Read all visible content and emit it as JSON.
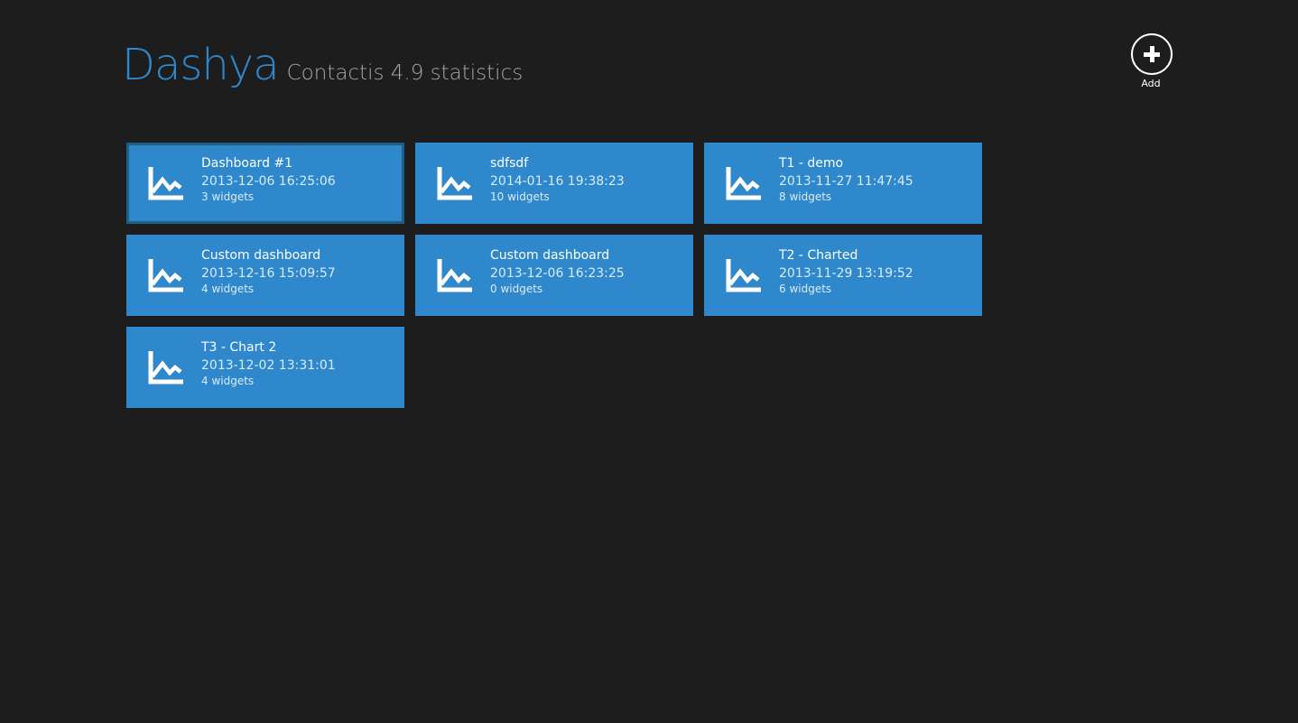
{
  "header": {
    "title": "Dashya",
    "subtitle": "Contactis 4.9 statistics"
  },
  "appbar": {
    "add_label": "Add",
    "add_icon": "plus-icon"
  },
  "colors": {
    "background": "#1d1d1d",
    "accent": "#2e88cb",
    "title": "#2e88cb",
    "subtitle": "#a7a7a7"
  },
  "dashboards": [
    {
      "name": "Dashboard #1",
      "date": "2013-12-06 16:25:06",
      "widgets": "3 widgets",
      "icon": "line-chart-icon",
      "selected": true
    },
    {
      "name": "sdfsdf",
      "date": "2014-01-16 19:38:23",
      "widgets": "10 widgets",
      "icon": "line-chart-icon",
      "selected": false
    },
    {
      "name": "T1 - demo",
      "date": "2013-11-27 11:47:45",
      "widgets": "8 widgets",
      "icon": "line-chart-icon",
      "selected": false
    },
    {
      "name": "Custom dashboard",
      "date": "2013-12-16 15:09:57",
      "widgets": "4 widgets",
      "icon": "line-chart-icon",
      "selected": false
    },
    {
      "name": "Custom dashboard",
      "date": "2013-12-06 16:23:25",
      "widgets": "0 widgets",
      "icon": "line-chart-icon",
      "selected": false
    },
    {
      "name": "T2 - Charted",
      "date": "2013-11-29 13:19:52",
      "widgets": "6 widgets",
      "icon": "line-chart-icon",
      "selected": false
    },
    {
      "name": "T3 - Chart 2",
      "date": "2013-12-02 13:31:01",
      "widgets": "4 widgets",
      "icon": "line-chart-icon",
      "selected": false
    }
  ]
}
